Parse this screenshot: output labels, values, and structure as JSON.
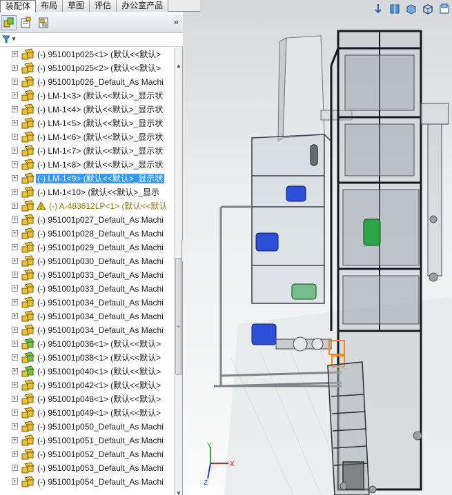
{
  "tabs": [
    {
      "label": "装配体",
      "active": true
    },
    {
      "label": "布局",
      "active": false
    },
    {
      "label": "草图",
      "active": false
    },
    {
      "label": "评估",
      "active": false
    },
    {
      "label": "办公室产品",
      "active": false
    }
  ],
  "toolbar": {
    "icons": [
      "feature-manager-icon",
      "property-manager-icon",
      "configuration-manager-icon"
    ],
    "overflow": "»"
  },
  "filter": {
    "icon": "filter-icon",
    "dropdown": "▼"
  },
  "tree": [
    {
      "label": "(-) 951001p025<1> (默认<<默认>",
      "state": "normal",
      "icon": "part-yellow"
    },
    {
      "label": "(-) 951001p025<2> (默认<<默认>",
      "state": "normal",
      "icon": "part-yellow"
    },
    {
      "label": "(-) 951001p026_Default_As Machi",
      "state": "normal",
      "icon": "part-yellow"
    },
    {
      "label": "(-) LM-1<3> (默认<<默认>_显示状",
      "state": "normal",
      "icon": "part-yellow"
    },
    {
      "label": "(-) LM-1<4> (默认<<默认>_显示状",
      "state": "normal",
      "icon": "part-yellow"
    },
    {
      "label": "(-) LM-1<5> (默认<<默认>_显示状",
      "state": "normal",
      "icon": "part-yellow"
    },
    {
      "label": "(-) LM-1<6> (默认<<默认>_显示状",
      "state": "normal",
      "icon": "part-yellow"
    },
    {
      "label": "(-) LM-1<7> (默认<<默认>_显示状",
      "state": "normal",
      "icon": "part-yellow"
    },
    {
      "label": "(-) LM-1<8> (默认<<默认>_显示状",
      "state": "normal",
      "icon": "part-yellow"
    },
    {
      "label": "(-) LM-1<9> (默认<<默认>_显示状",
      "state": "selected",
      "icon": "part-yellow"
    },
    {
      "label": "(-) LM-1<10> (默认<<默认>_显示",
      "state": "normal",
      "icon": "part-yellow"
    },
    {
      "label": "(-) A-483612LP<1> (默认<<默认",
      "state": "warning",
      "icon": "part-yellow"
    },
    {
      "label": "(-) 951001p027_Default_As Machi",
      "state": "normal",
      "icon": "part-yellow"
    },
    {
      "label": "(-) 951001p028_Default_As Machi",
      "state": "normal",
      "icon": "part-yellow"
    },
    {
      "label": "(-) 951001p029_Default_As Machi",
      "state": "normal",
      "icon": "part-yellow"
    },
    {
      "label": "(-) 951001p030_Default_As Machi",
      "state": "normal",
      "icon": "part-yellow"
    },
    {
      "label": "(-) 951001p033_Default_As Machi",
      "state": "normal",
      "icon": "part-yellow"
    },
    {
      "label": "(-) 951001p033_Default_As Machi",
      "state": "normal",
      "icon": "part-yellow"
    },
    {
      "label": "(-) 951001p034_Default_As Machi",
      "state": "normal",
      "icon": "part-yellow"
    },
    {
      "label": "(-) 951001p034_Default_As Machi",
      "state": "normal",
      "icon": "part-yellow"
    },
    {
      "label": "(-) 951001p034_Default_As Machi",
      "state": "normal",
      "icon": "part-yellow"
    },
    {
      "label": "(-) 951001p036<1> (默认<<默认>",
      "state": "normal",
      "icon": "part-green"
    },
    {
      "label": "(-) 951001p038<1> (默认<<默认>",
      "state": "normal",
      "icon": "part-green"
    },
    {
      "label": "(-) 951001p040<1> (默认<<默认>",
      "state": "normal",
      "icon": "part-green"
    },
    {
      "label": "(-) 951001p042<1> (默认<<默认>",
      "state": "normal",
      "icon": "part-yellow"
    },
    {
      "label": "(-) 951001p048<1> (默认<<默认>",
      "state": "normal",
      "icon": "part-yellow"
    },
    {
      "label": "(-) 951001p049<1> (默认<<默认>",
      "state": "normal",
      "icon": "part-yellow"
    },
    {
      "label": "(-) 951001p050_Default_As Machi",
      "state": "normal",
      "icon": "part-yellow"
    },
    {
      "label": "(-) 951001p051_Default_As Machi",
      "state": "normal",
      "icon": "part-yellow"
    },
    {
      "label": "(-) 951001p052_Default_As Machi",
      "state": "normal",
      "icon": "part-yellow"
    },
    {
      "label": "(-) 951001p053_Default_As Machi",
      "state": "normal",
      "icon": "part-yellow"
    },
    {
      "label": "(-) 951001p054_Default_As Machi",
      "state": "normal",
      "icon": "part-yellow"
    }
  ],
  "view": {
    "hud_icons": [
      "view-orientation-icon",
      "section-view-icon",
      "display-style-icon",
      "view-cube-icon",
      "hide-show-icon"
    ],
    "triad": {
      "x": "X",
      "y": "Y",
      "z": "Z"
    }
  },
  "colors": {
    "selection": "#3399ff",
    "warning_text": "#9a7a00",
    "frame_dark": "#1a1d22",
    "motor_blue": "#2d4fd8",
    "motor_green": "#2fa34a",
    "highlight_orange": "#f08a1c"
  }
}
